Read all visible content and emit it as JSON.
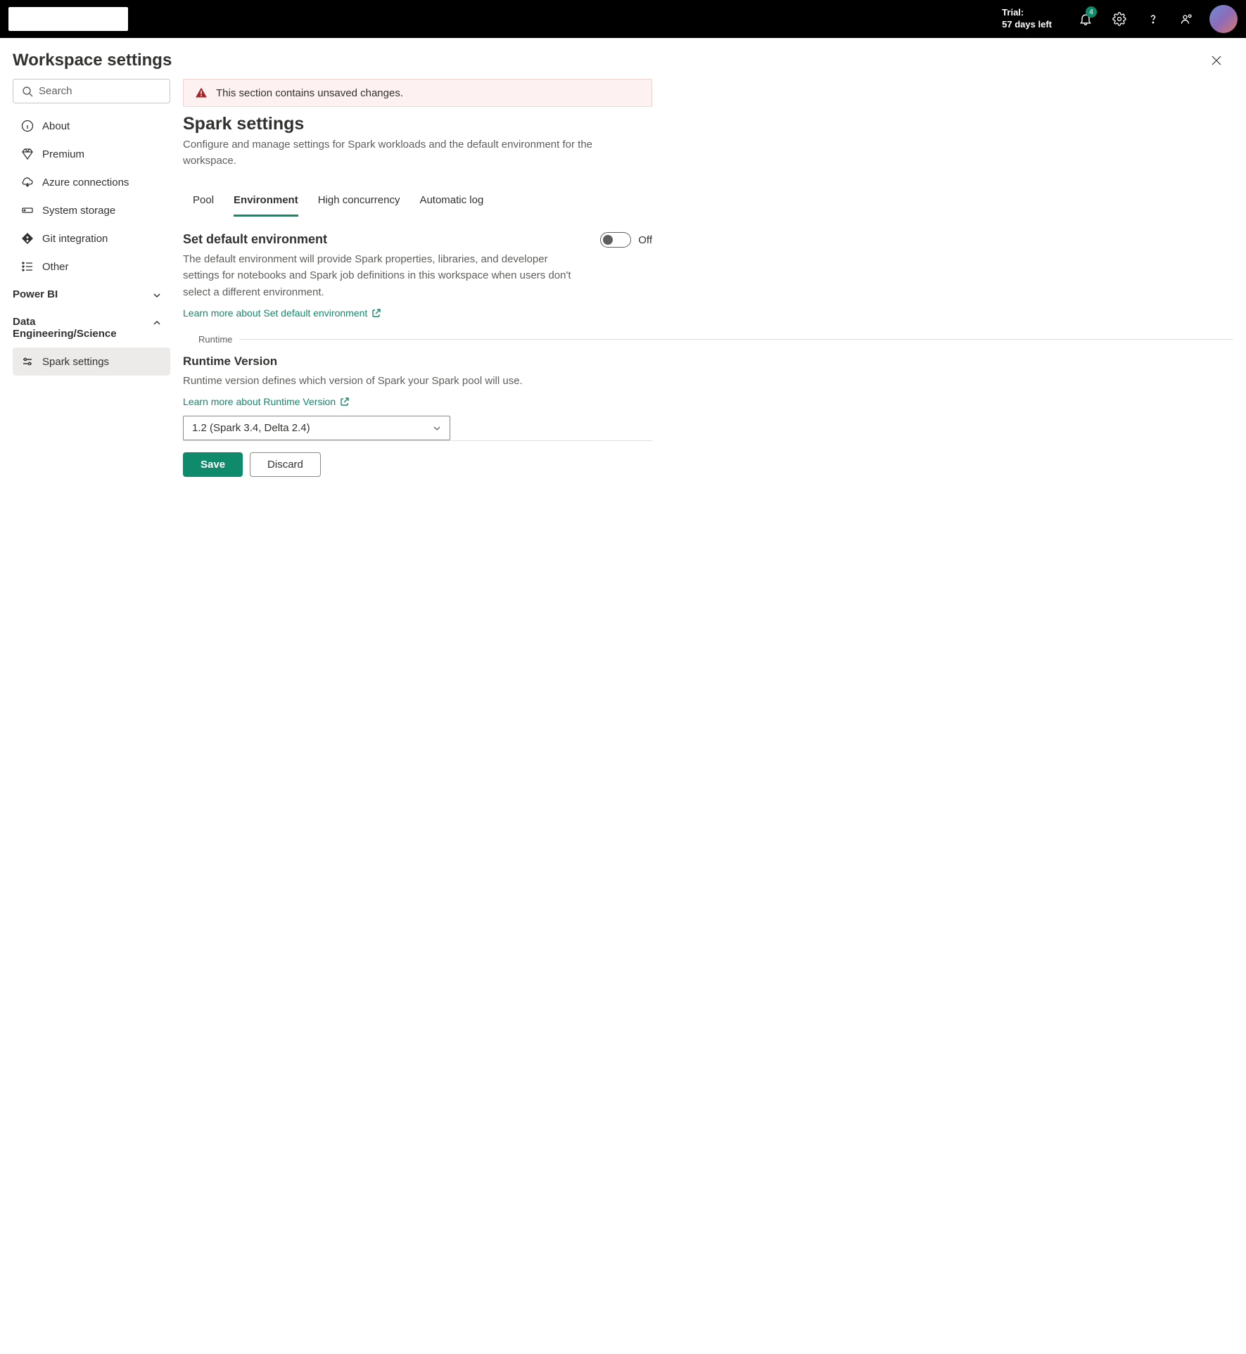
{
  "topbar": {
    "trial_line1": "Trial:",
    "trial_line2": "57 days left",
    "notification_count": "4"
  },
  "page": {
    "title": "Workspace settings",
    "search_placeholder": "Search"
  },
  "sidebar": {
    "items": [
      {
        "label": "About"
      },
      {
        "label": "Premium"
      },
      {
        "label": "Azure connections"
      },
      {
        "label": "System storage"
      },
      {
        "label": "Git integration"
      },
      {
        "label": "Other"
      }
    ],
    "groups": [
      {
        "label": "Power BI",
        "expanded": false
      },
      {
        "label": "Data Engineering/Science",
        "expanded": true
      }
    ],
    "sub_items": [
      {
        "label": "Spark settings"
      }
    ]
  },
  "content": {
    "alert": "This section contains unsaved changes.",
    "section_title": "Spark settings",
    "section_desc": "Configure and manage settings for Spark workloads and the default environment for the workspace.",
    "tabs": [
      {
        "label": "Pool"
      },
      {
        "label": "Environment"
      },
      {
        "label": "High concurrency"
      },
      {
        "label": "Automatic log"
      }
    ],
    "default_env": {
      "title": "Set default environment",
      "desc": "The default environment will provide Spark properties, libraries, and developer settings for notebooks and Spark job definitions in this workspace when users don't select a different environment.",
      "toggle_state": "Off",
      "learn_more": "Learn more about Set default environment"
    },
    "runtime_group": "Runtime",
    "runtime": {
      "title": "Runtime Version",
      "desc": "Runtime version defines which version of Spark your Spark pool will use.",
      "learn_more": "Learn more about Runtime Version",
      "selected": "1.2 (Spark 3.4, Delta 2.4)"
    },
    "footer": {
      "save": "Save",
      "discard": "Discard"
    }
  }
}
